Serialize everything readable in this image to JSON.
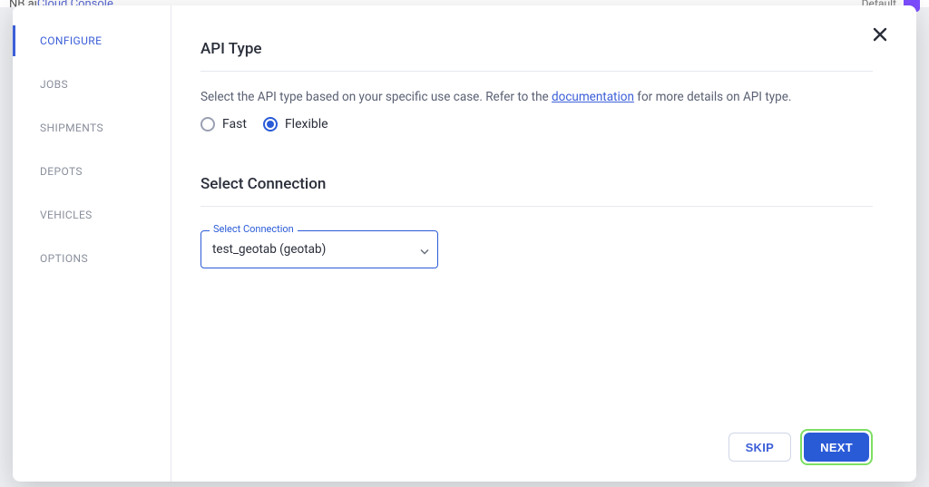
{
  "background": {
    "brand_prefix": "NB ai ",
    "brand_suffix": "Cloud Console",
    "right_label": "Default"
  },
  "sidebar": {
    "items": [
      {
        "label": "CONFIGURE",
        "active": true
      },
      {
        "label": "JOBS",
        "active": false
      },
      {
        "label": "SHIPMENTS",
        "active": false
      },
      {
        "label": "DEPOTS",
        "active": false
      },
      {
        "label": "VEHICLES",
        "active": false
      },
      {
        "label": "OPTIONS",
        "active": false
      }
    ]
  },
  "apiType": {
    "title": "API Type",
    "help_pre": "Select the API type based on your specific use case. Refer to the ",
    "help_link": "documentation",
    "help_post": " for more details on API type.",
    "options": [
      {
        "label": "Fast",
        "checked": false
      },
      {
        "label": "Flexible",
        "checked": true
      }
    ]
  },
  "connection": {
    "title": "Select Connection",
    "field_label": "Select Connection",
    "value": "test_geotab (geotab)"
  },
  "footer": {
    "skip": "SKIP",
    "next": "NEXT"
  }
}
